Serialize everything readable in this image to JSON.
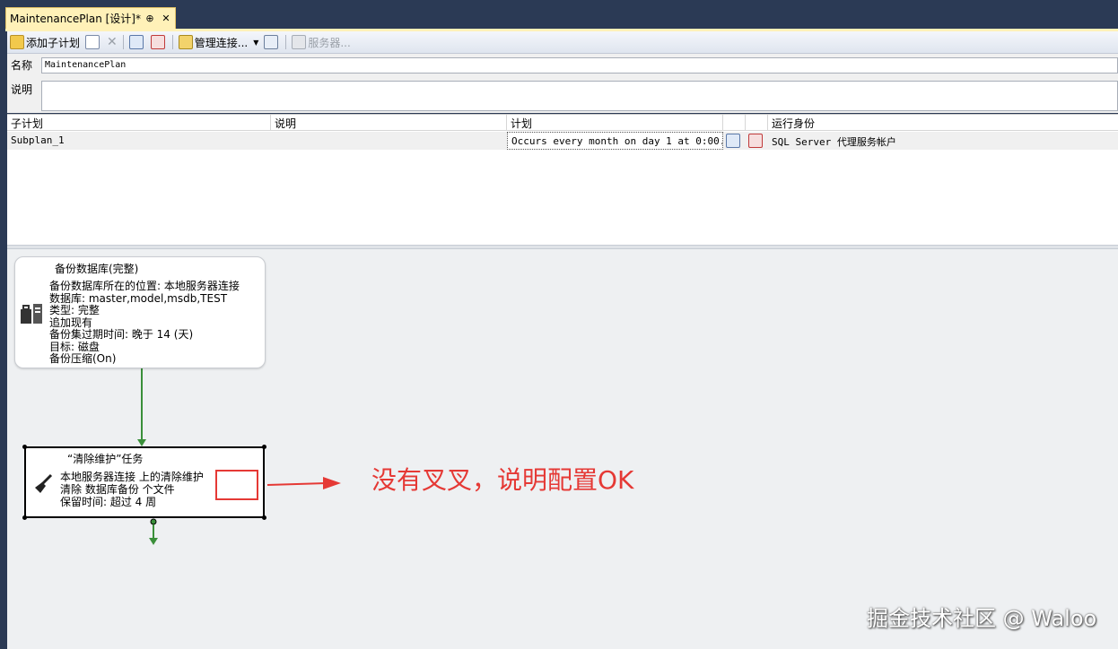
{
  "tab": {
    "title": "MaintenancePlan [设计]*",
    "pin_glyph": "⊕",
    "close_glyph": "✕"
  },
  "toolbar": {
    "add_subplan": "添加子计划",
    "manage_connections": "管理连接...",
    "servers": "服务器..."
  },
  "form": {
    "name_label": "名称",
    "name_value": "MaintenancePlan",
    "desc_label": "说明",
    "desc_value": ""
  },
  "grid": {
    "columns": [
      "子计划",
      "说明",
      "计划",
      "",
      "",
      "运行身份"
    ],
    "rows": [
      {
        "subplan": "Subplan_1",
        "description": "",
        "schedule": "Occurs every month on day 1 at 0:00...",
        "run_as": "SQL Server 代理服务帐户"
      }
    ]
  },
  "tasks": {
    "backup": {
      "title": "备份数据库(完整)",
      "lines": [
        "备份数据库所在的位置: 本地服务器连接",
        "数据库: master,model,msdb,TEST",
        "类型: 完整",
        "追加现有",
        "备份集过期时间: 晚于 14 (天)",
        "目标: 磁盘",
        "备份压缩(On)"
      ]
    },
    "cleanup": {
      "title": "“清除维护”任务",
      "lines": [
        "本地服务器连接 上的清除维护",
        "清除 数据库备份 个文件",
        "保留时间: 超过 4 周"
      ]
    }
  },
  "annotation": "没有叉叉，说明配置OK",
  "watermark": "掘金技术社区 @ Waloo",
  "colors": {
    "accent_red": "#e53935",
    "connector_green": "#3a8f3a",
    "tab_yellow": "#fff1b8",
    "frame_blue": "#2b3a55"
  },
  "icons": [
    "add-subplan-icon",
    "edit-icon",
    "delete-icon",
    "calendar-icon",
    "delete-schedule-icon",
    "manage-connections-icon",
    "copy-icon",
    "servers-icon",
    "backup-task-icon",
    "cleanup-task-icon"
  ]
}
